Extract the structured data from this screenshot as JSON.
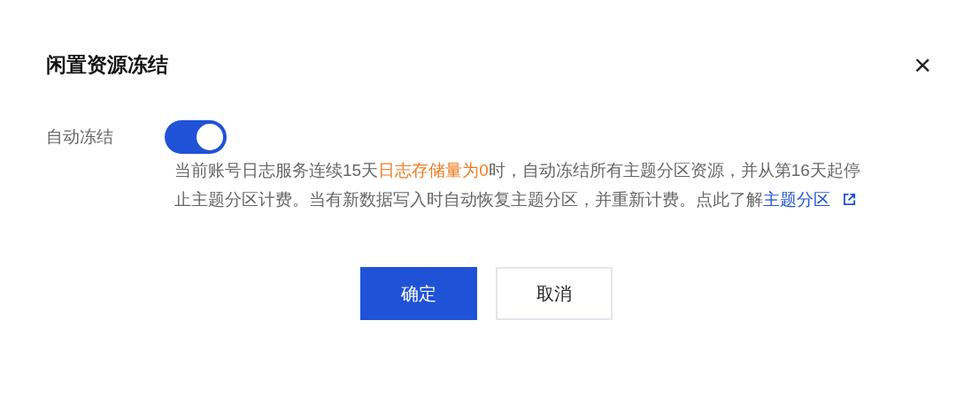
{
  "dialog": {
    "title": "闲置资源冻结",
    "close": "×"
  },
  "setting": {
    "label": "自动冻结",
    "toggle": {
      "on": true
    },
    "description": {
      "before": "当前账号日志服务连续15天",
      "highlight": "日志存储量为0",
      "after": "时，自动冻结所有主题分区资源，并从第16天起停止主题分区计费。当有新数据写入时自动恢复主题分区，并重新计费。点此了解",
      "link": "主题分区"
    }
  },
  "buttons": [
    {
      "kind": "primary",
      "label": "确定"
    },
    {
      "kind": "secondary",
      "label": "取消"
    }
  ]
}
